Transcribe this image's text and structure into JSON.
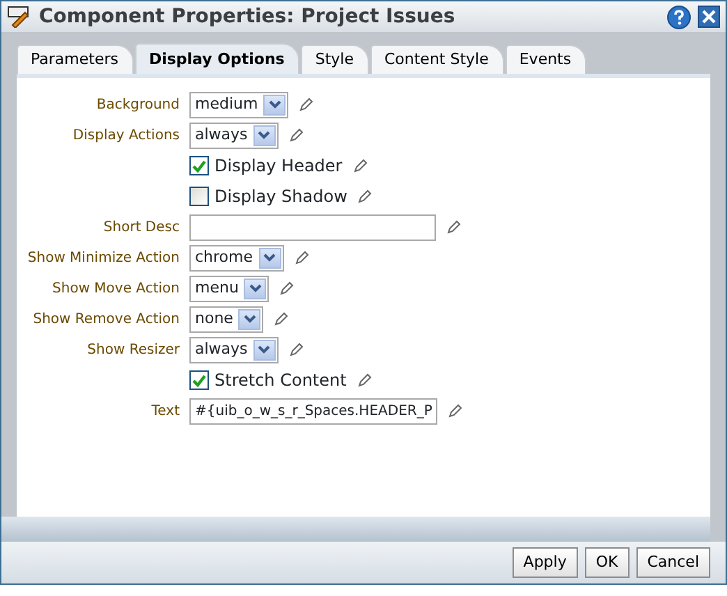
{
  "window": {
    "title": "Component Properties: Project Issues"
  },
  "tabs": [
    {
      "label": "Parameters",
      "selected": false
    },
    {
      "label": "Display Options",
      "selected": true
    },
    {
      "label": "Style",
      "selected": false
    },
    {
      "label": "Content Style",
      "selected": false
    },
    {
      "label": "Events",
      "selected": false
    }
  ],
  "fields": [
    {
      "kind": "select",
      "label": "Background",
      "value": "medium"
    },
    {
      "kind": "select",
      "label": "Display Actions",
      "value": "always"
    },
    {
      "kind": "checkbox",
      "label": "Display Header",
      "checked": true
    },
    {
      "kind": "checkbox",
      "label": "Display Shadow",
      "checked": false
    },
    {
      "kind": "text",
      "label": "Short Desc"
    },
    {
      "kind": "select",
      "label": "Show Minimize Action",
      "value": "chrome"
    },
    {
      "kind": "select",
      "label": "Show Move Action",
      "value": "menu"
    },
    {
      "kind": "select",
      "label": "Show Remove Action",
      "value": "none"
    },
    {
      "kind": "select",
      "label": "Show Resizer",
      "value": "always"
    },
    {
      "kind": "checkbox",
      "label": "Stretch Content",
      "checked": true
    },
    {
      "kind": "text",
      "label": "Text",
      "value": "#{uib_o_w_s_r_Spaces.HEADER_P"
    }
  ],
  "buttons": [
    "Apply",
    "OK",
    "Cancel"
  ]
}
